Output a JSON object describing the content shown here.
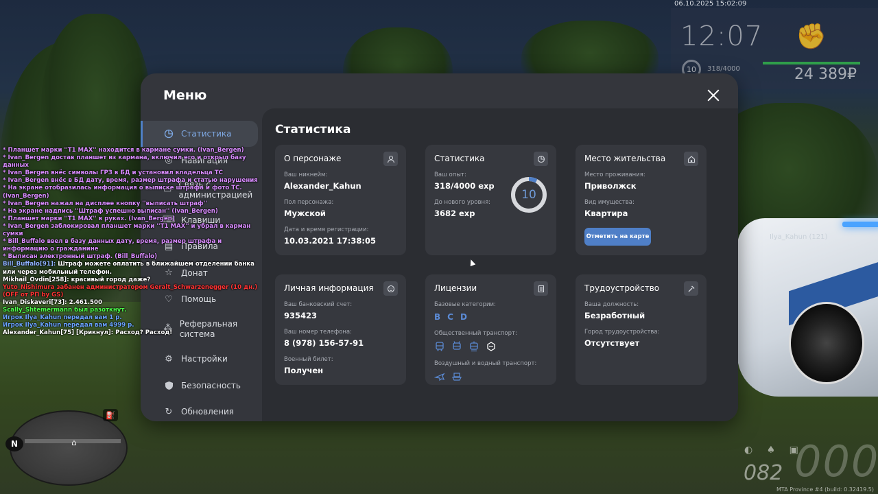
{
  "hud": {
    "datetime": "06.10.2025 15:02:09",
    "clock": "12:07",
    "level": "10",
    "exp": "318/4000",
    "money": "24 389₽",
    "fuel": "082",
    "speed": "000",
    "build": "MTA Province #4 (build: 0.32419.5)",
    "npc_tag": "Ilya_Kahun (121)"
  },
  "menu": {
    "title": "Меню",
    "sidebar": [
      {
        "label": "Статистика",
        "icon": "pie-chart-icon",
        "active": true
      },
      {
        "label": "Навигация",
        "icon": "compass-icon"
      },
      {
        "label": "Связь с администрацией",
        "icon": "chat-icon"
      },
      {
        "label": "Клавиши",
        "icon": "keyboard-icon"
      },
      {
        "label": "Правила",
        "icon": "book-icon"
      },
      {
        "label": "Донат",
        "icon": "star-icon"
      },
      {
        "label": "Помощь",
        "icon": "handshake-icon"
      },
      {
        "label": "Реферальная система",
        "icon": "network-icon"
      },
      {
        "label": "Настройки",
        "icon": "gear-icon"
      },
      {
        "label": "Безопасность",
        "icon": "shield-icon"
      },
      {
        "label": "Обновления",
        "icon": "refresh-icon"
      }
    ],
    "content_title": "Статистика",
    "character": {
      "title": "О персонаже",
      "nick_label": "Ваш никнейм:",
      "nick": "Alexander_Kahun",
      "gender_label": "Пол персонажа:",
      "gender": "Мужской",
      "reg_label": "Дата и время регистрации:",
      "reg": "10.03.2021 17:38:05"
    },
    "stats": {
      "title": "Статистика",
      "exp_label": "Ваш опыт:",
      "exp": "318/4000 exp",
      "next_label": "До нового уровня:",
      "next": "3682 exp",
      "level": "10",
      "level_progress": 0.0795
    },
    "residence": {
      "title": "Место жительства",
      "place_label": "Место проживания:",
      "place": "Приволжск",
      "type_label": "Вид имущества:",
      "type": "Квартира",
      "button": "Отметить на карте"
    },
    "personal": {
      "title": "Личная информация",
      "bank_label": "Ваш банковский счет:",
      "bank": "935423",
      "phone_label": "Ваш номер телефона:",
      "phone": "8 (978) 156-57-91",
      "military_label": "Военный билет:",
      "military": "Получен"
    },
    "licenses": {
      "title": "Лицензии",
      "base_label": "Базовые категории:",
      "categories": [
        "B",
        "C",
        "D"
      ],
      "public_label": "Общественный транспорт:",
      "air_label": "Воздушный и водный транспорт:"
    },
    "employment": {
      "title": "Трудоустройство",
      "position_label": "Ваша должность:",
      "position": "Безработный",
      "city_label": "Город трудоустройства:",
      "city": "Отсутствует"
    }
  },
  "chat": [
    {
      "color": "purple",
      "text": "* Планшет марки ''T1 MAX'' находится в кармане сумки. (Ivan_Bergen)"
    },
    {
      "color": "purple",
      "text": "* Ivan_Bergen достав планшет из кармана, включил его и открыл базу данных"
    },
    {
      "color": "purple",
      "text": "* Ivan_Bergen внёс символы ГРЗ в БД и установил владельца ТС"
    },
    {
      "color": "purple",
      "text": "* Ivan_Bergen внёс в БД дату, время, размер штрафа и статью нарушения"
    },
    {
      "color": "purple",
      "text": "* На экране отобразилась информация о выписке штрафа и фото ТС. (Ivan_Bergen)"
    },
    {
      "color": "purple",
      "text": "* Ivan_Bergen нажал на дисплее кнопку ''выписать штраф''"
    },
    {
      "color": "purple",
      "text": "* На экране надпись ''Штраф успешно выписан'' (Ivan_Bergen)"
    },
    {
      "color": "purple",
      "text": "* Планшет марки ''T1 MAX'' в руках. (Ivan_Bergen)"
    },
    {
      "color": "purple",
      "text": "* Ivan_Bergen заблокировал планшет марки ''T1 MAX'' и убрал в карман сумки"
    },
    {
      "color": "purple",
      "text": "* Bill_Buffalo ввел в базу данных дату, время, размер штрафа и информацию о гражданине"
    },
    {
      "color": "purple",
      "text": "* Выписан электронный штраф. (Bill_Buffalo)"
    },
    {
      "color": "blue",
      "text": "Bill_Buffalo[91]:",
      "rest": " Штраф можете оплатить в ближайшем отделении банка или через мобильный телефон."
    },
    {
      "color": "white",
      "text": "Mikhail_Ovdin[258]: красивый город даже?"
    },
    {
      "color": "red",
      "text": "Yuto_Nishimura забанен администратором Geralt_Schwarzenegger (10 дн.) (OFF от РП by GS)"
    },
    {
      "color": "white",
      "text": "Ivan_Diskaveri[73]: 2.461.500"
    },
    {
      "color": "green",
      "text": "Scally_Shtemermann был разоткнут."
    },
    {
      "color": "lblue",
      "text": "Игрок Ilya_Kahun передал вам 1 р."
    },
    {
      "color": "lblue",
      "text": "Игрок Ilya_Kahun передал вам 4999 р."
    },
    {
      "color": "white",
      "text": "Alexander_Kahun[75] [Крикнул]: Расход? Расход!"
    }
  ]
}
